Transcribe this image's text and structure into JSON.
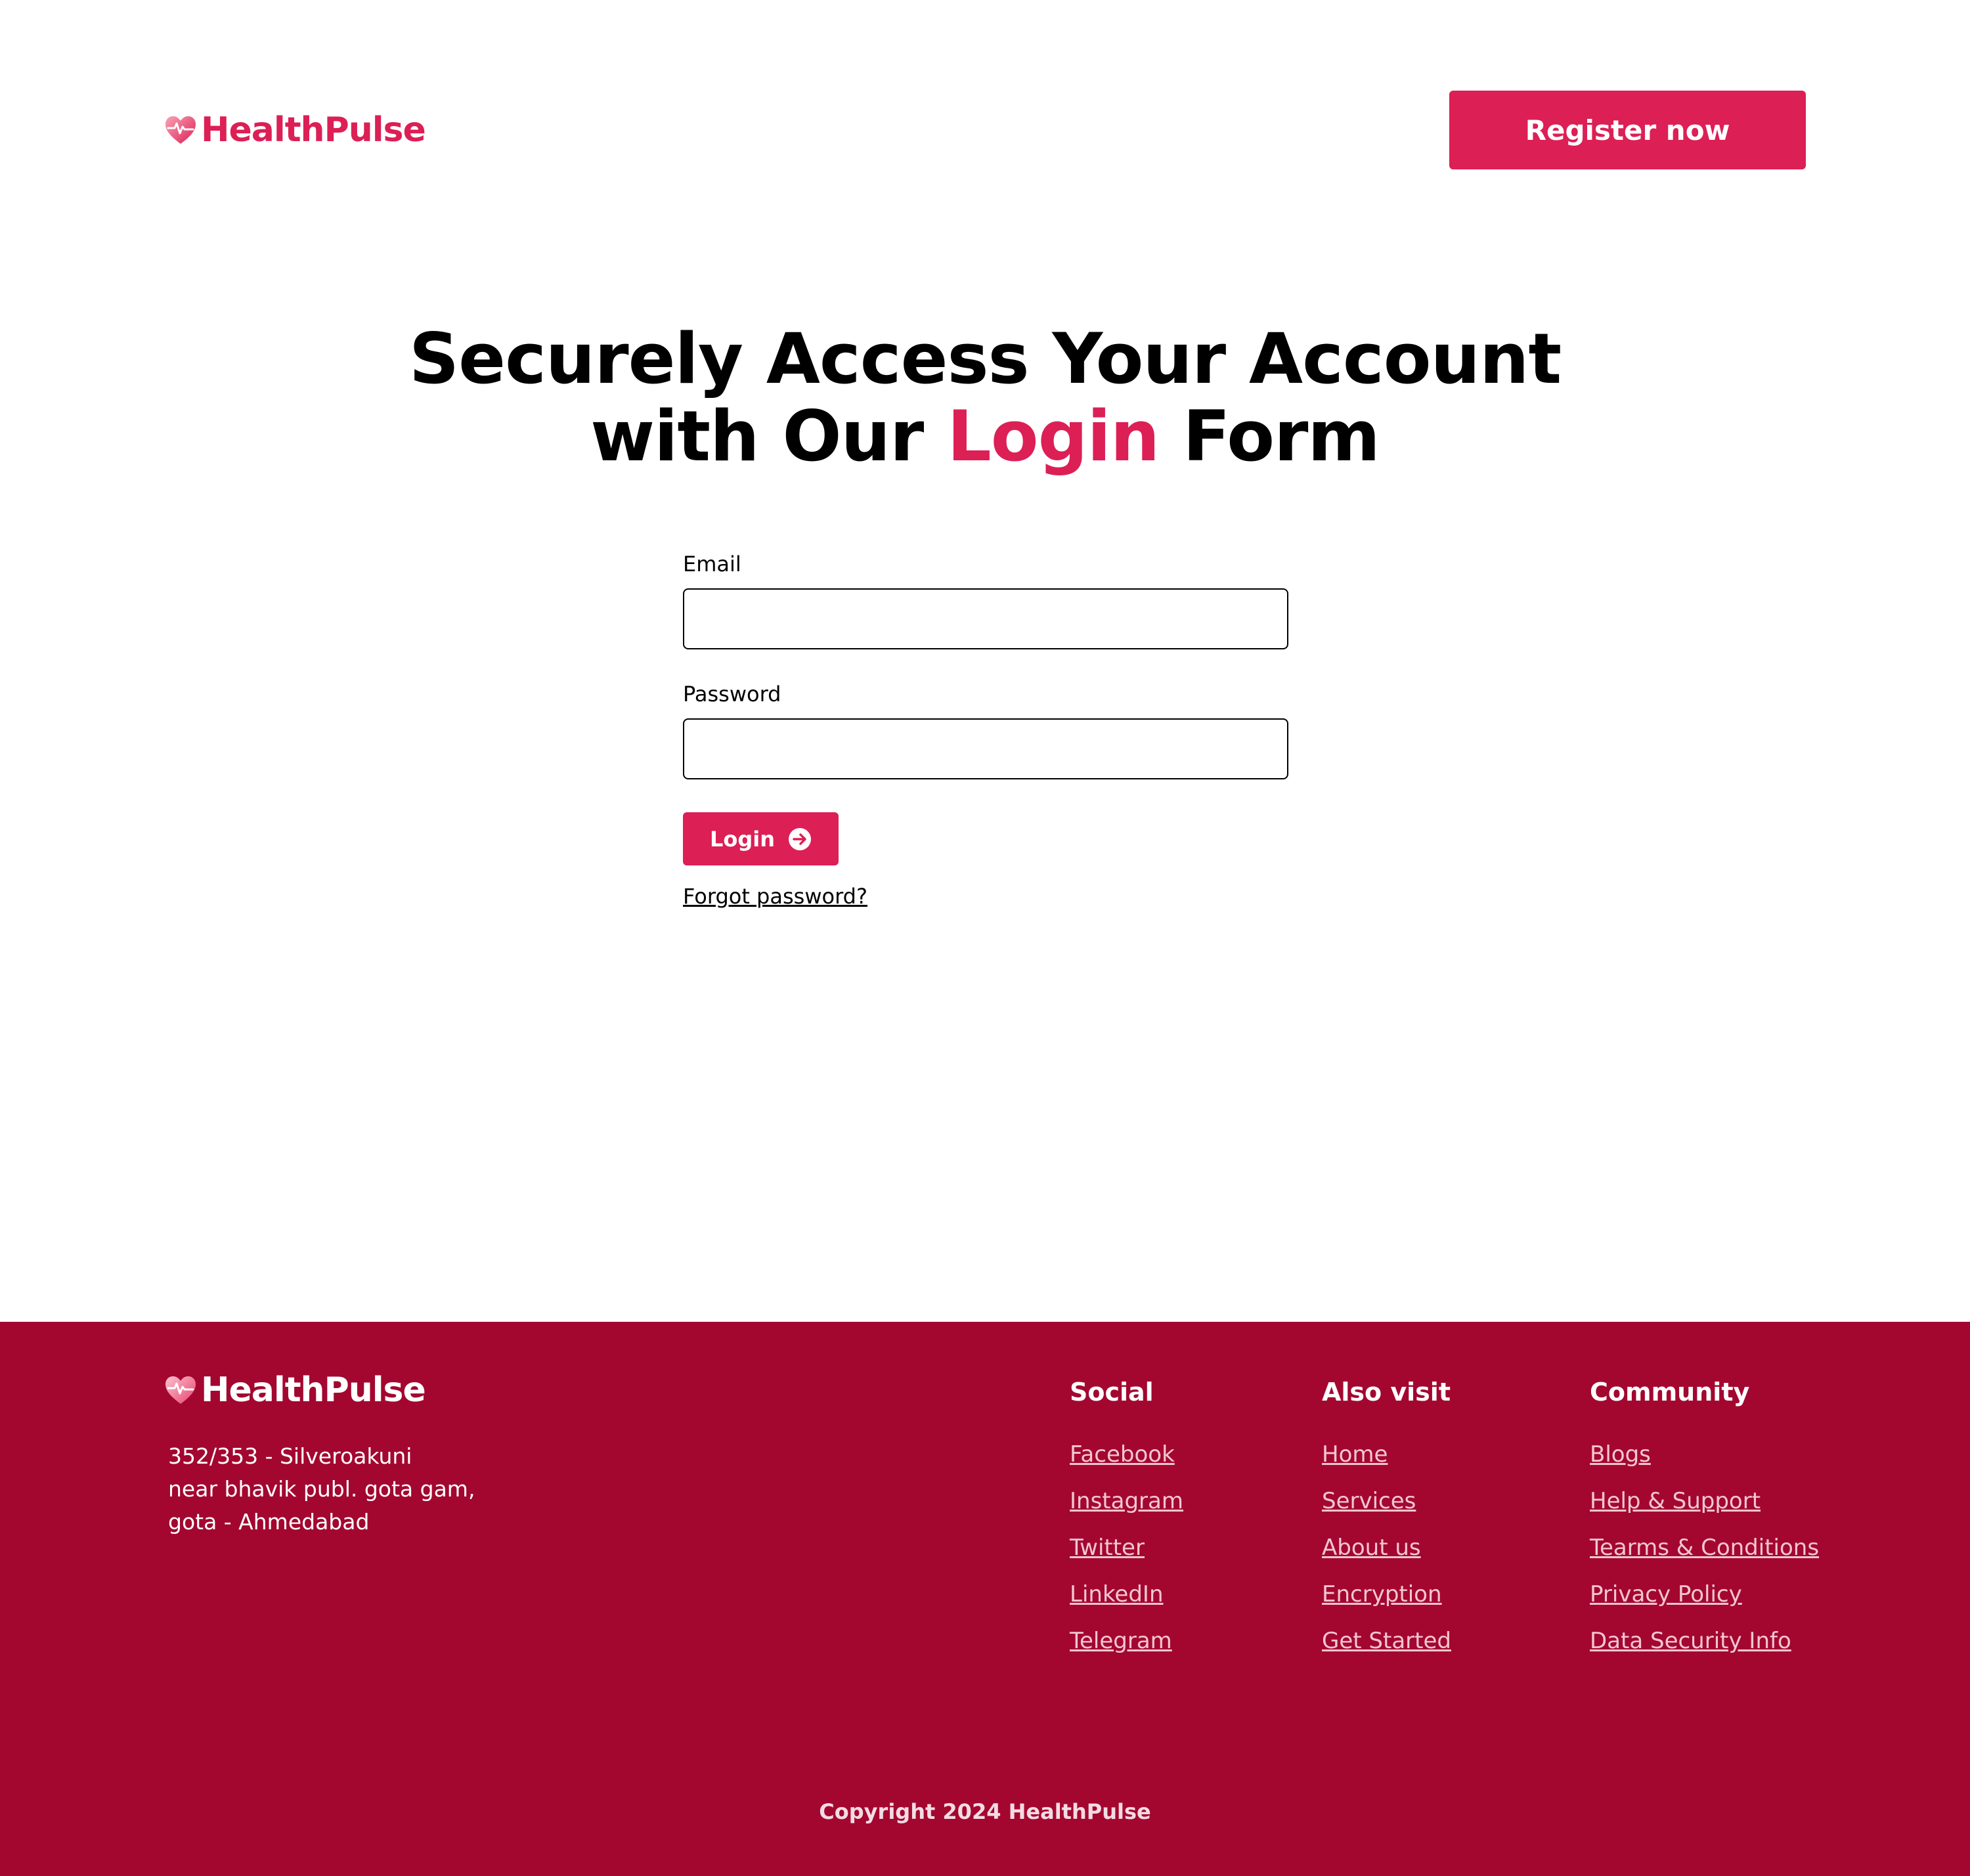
{
  "brand": {
    "name": "HealthPulse",
    "icon": "heart-pulse-icon",
    "accent_color": "#dc1f55",
    "footer_color": "#a3072f"
  },
  "header": {
    "register_label": "Register now"
  },
  "hero": {
    "line1": "Securely Access Your Account",
    "line2_before": "with Our ",
    "line2_accent": "Login",
    "line2_after": " Form"
  },
  "form": {
    "email_label": "Email",
    "email_value": "",
    "password_label": "Password",
    "password_value": "",
    "login_label": "Login",
    "login_icon": "arrow-right-circle-icon",
    "forgot_label": "Forgot password?"
  },
  "footer": {
    "address": [
      "352/353 - Silveroakuni",
      "near bhavik publ. gota gam,",
      "gota - Ahmedabad"
    ],
    "columns": [
      {
        "title": "Social",
        "links": [
          "Facebook",
          "Instagram",
          "Twitter",
          "LinkedIn",
          "Telegram"
        ]
      },
      {
        "title": "Also visit",
        "links": [
          "Home",
          "Services",
          "About us",
          "Encryption",
          "Get Started"
        ]
      },
      {
        "title": "Community",
        "links": [
          "Blogs",
          "Help & Support",
          "Tearms & Conditions",
          "Privacy Policy",
          "Data Security Info"
        ]
      }
    ],
    "copyright": "Copyright 2024 HealthPulse"
  }
}
